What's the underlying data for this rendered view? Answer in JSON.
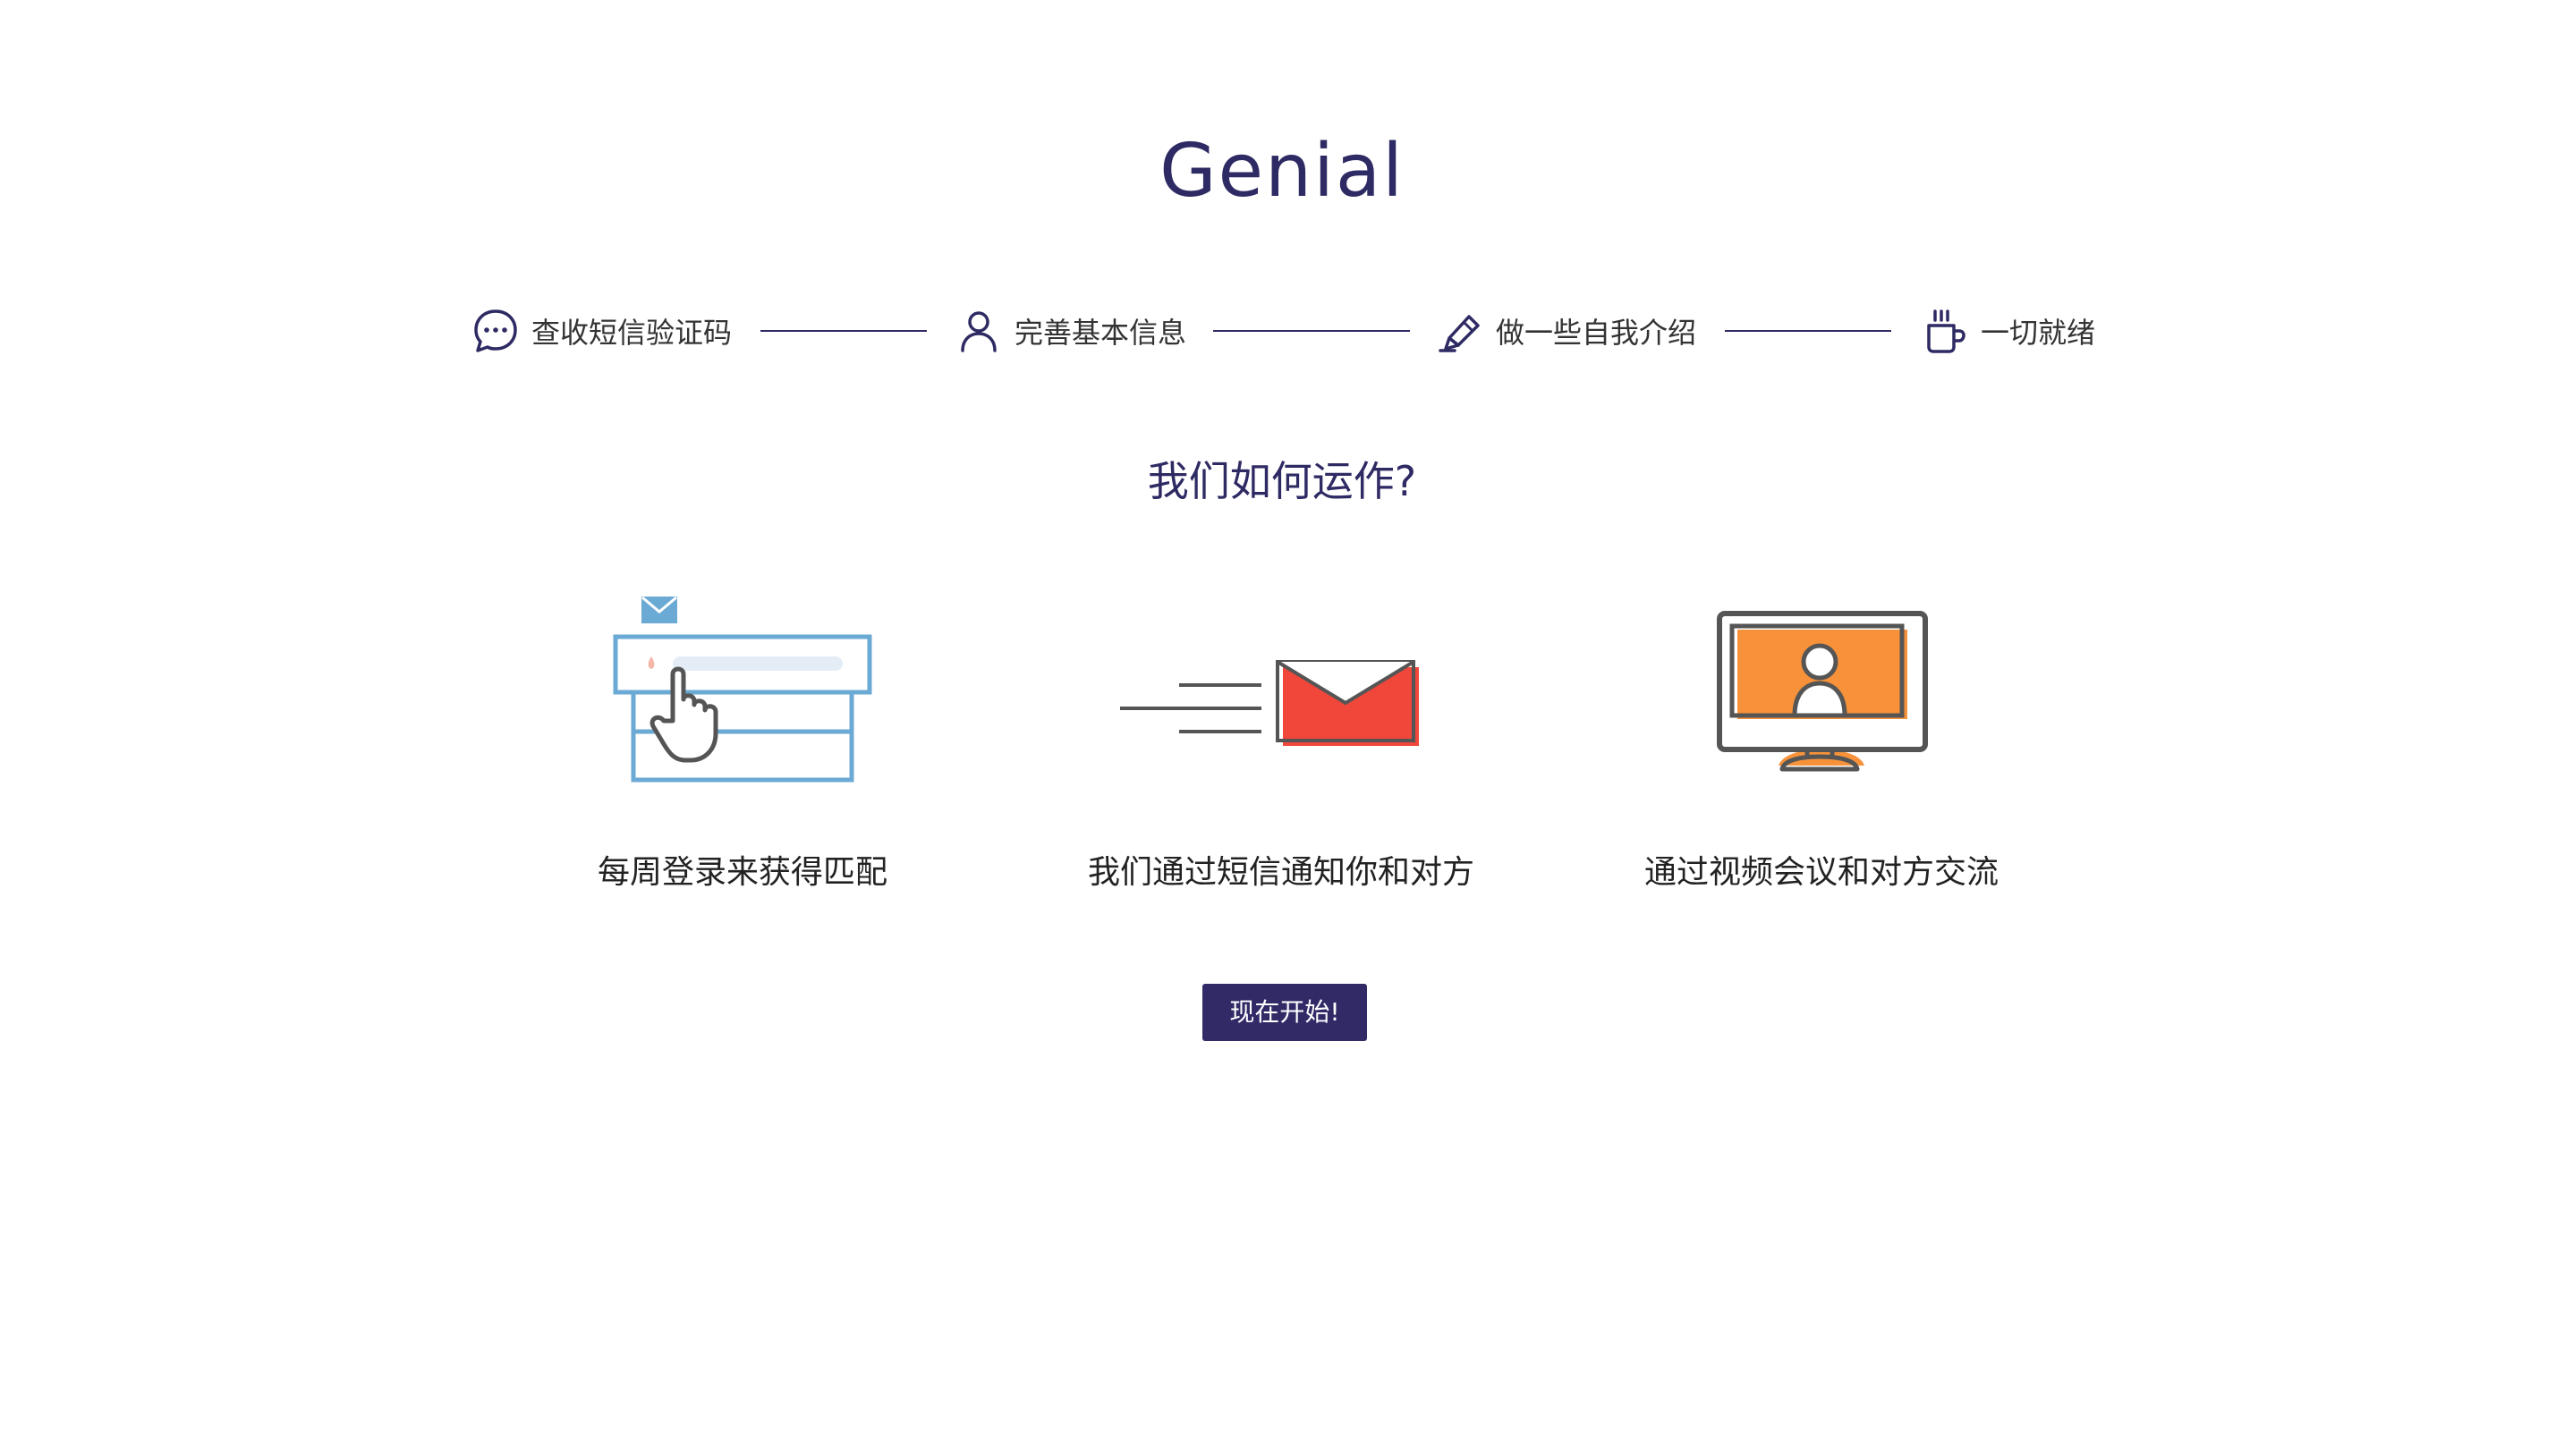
{
  "brand": {
    "name": "Genial",
    "color": "#2e2a63"
  },
  "steps": [
    {
      "label": "查收短信验证码",
      "icon": "chat-bubble-icon"
    },
    {
      "label": "完善基本信息",
      "icon": "user-icon"
    },
    {
      "label": "做一些自我介绍",
      "icon": "pen-icon"
    },
    {
      "label": "一切就绪",
      "icon": "coffee-cup-icon"
    }
  ],
  "how_it_works": {
    "title": "我们如何运作?",
    "features": [
      {
        "caption": "每周登录来获得匹配",
        "icon": "login-click-illustration"
      },
      {
        "caption": "我们通过短信通知你和对方",
        "icon": "message-envelope-illustration"
      },
      {
        "caption": "通过视频会议和对方交流",
        "icon": "video-monitor-illustration"
      }
    ]
  },
  "cta": {
    "label": "现在开始!",
    "color": "#322a66"
  },
  "colors": {
    "illustration_blue": "#6aaad4",
    "envelope_red": "#f0473a",
    "monitor_orange": "#f7923a",
    "stroke_gray": "#555555"
  }
}
